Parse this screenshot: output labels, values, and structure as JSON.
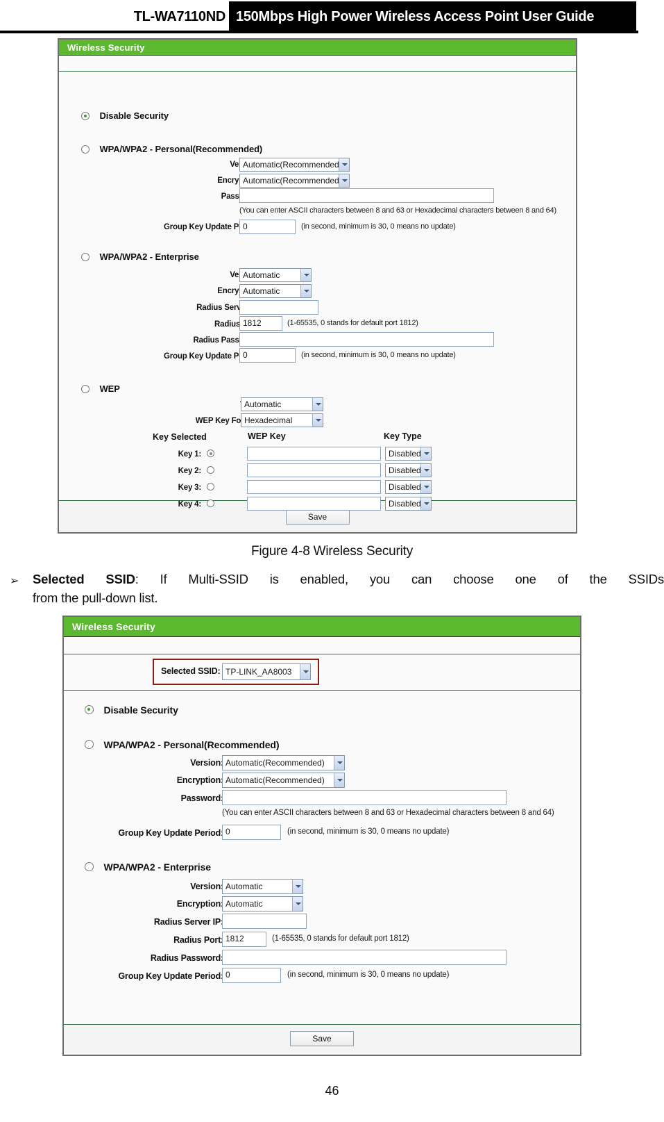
{
  "doc": {
    "model": "TL-WA7110ND",
    "title": "150Mbps High Power Wireless Access Point User Guide",
    "page_number": "46",
    "figure_caption": "Figure 4-8 Wireless Security",
    "bullet": {
      "marker": "➢",
      "term": "Selected SSID",
      "line1_rest": ": If Multi-SSID is enabled, you can choose one of the SSIDs",
      "line2": "from   the pull-down list."
    }
  },
  "colors": {
    "panel_green": "#5cb82e",
    "highlight_red": "#8c1f14",
    "radio_dot_green": "#3f9b2e"
  },
  "panel1": {
    "title": "Wireless Security",
    "save_label": "Save",
    "options": {
      "disable": "Disable Security",
      "personal": "WPA/WPA2 - Personal(Recommended)",
      "enterprise": "WPA/WPA2 - Enterprise",
      "wep": "WEP"
    },
    "selected_option": "disable",
    "personal": {
      "version_label": "Version:",
      "version_value": "Automatic(Recommended)",
      "encryption_label": "Encryption:",
      "encryption_value": "Automatic(Recommended)",
      "password_label": "Password:",
      "password_value": "",
      "password_hint": "(You can enter ASCII characters between 8 and 63 or Hexadecimal characters between 8 and 64)",
      "group_key_label": "Group Key Update Period:",
      "group_key_value": "0",
      "group_key_hint": "(in second, minimum is 30, 0 means no update)"
    },
    "enterprise": {
      "version_label": "Version:",
      "version_value": "Automatic",
      "encryption_label": "Encryption:",
      "encryption_value": "Automatic",
      "radius_ip_label": "Radius Server IP:",
      "radius_ip_value": "",
      "radius_port_label": "Radius Port:",
      "radius_port_value": "1812",
      "radius_port_hint": "(1-65535, 0 stands for default port 1812)",
      "radius_password_label": "Radius Password:",
      "radius_password_value": "",
      "group_key_label": "Group Key Update Period:",
      "group_key_value": "0",
      "group_key_hint": "(in second, minimum is 30, 0 means no update)"
    },
    "wep": {
      "type_label": "Type:",
      "type_value": "Automatic",
      "key_format_label": "WEP Key Format:",
      "key_format_value": "Hexadecimal",
      "col_key_selected": "Key Selected",
      "col_wep_key": "WEP Key",
      "col_key_type": "Key Type",
      "keys": [
        {
          "label": "Key 1:",
          "selected": true,
          "value": "",
          "type": "Disabled"
        },
        {
          "label": "Key 2:",
          "selected": false,
          "value": "",
          "type": "Disabled"
        },
        {
          "label": "Key 3:",
          "selected": false,
          "value": "",
          "type": "Disabled"
        },
        {
          "label": "Key 4:",
          "selected": false,
          "value": "",
          "type": "Disabled"
        }
      ]
    }
  },
  "panel2": {
    "title": "Wireless Security",
    "save_label": "Save",
    "ssid": {
      "label": "Selected SSID:",
      "value": "TP-LINK_AA8003"
    },
    "options": {
      "disable": "Disable Security",
      "personal": "WPA/WPA2 - Personal(Recommended)",
      "enterprise": "WPA/WPA2 - Enterprise"
    },
    "selected_option": "disable",
    "personal": {
      "version_label": "Version:",
      "version_value": "Automatic(Recommended)",
      "encryption_label": "Encryption:",
      "encryption_value": "Automatic(Recommended)",
      "password_label": "Password:",
      "password_value": "",
      "password_hint": "(You can enter ASCII characters between 8 and 63 or Hexadecimal characters between 8 and 64)",
      "group_key_label": "Group Key Update Period:",
      "group_key_value": "0",
      "group_key_hint": "(in second, minimum is 30, 0 means no update)"
    },
    "enterprise": {
      "version_label": "Version:",
      "version_value": "Automatic",
      "encryption_label": "Encryption:",
      "encryption_value": "Automatic",
      "radius_ip_label": "Radius Server IP:",
      "radius_ip_value": "",
      "radius_port_label": "Radius Port:",
      "radius_port_value": "1812",
      "radius_port_hint": "(1-65535, 0 stands for default port 1812)",
      "radius_password_label": "Radius Password:",
      "radius_password_value": "",
      "group_key_label": "Group Key Update Period:",
      "group_key_value": "0",
      "group_key_hint": "(in second, minimum is 30, 0 means no update)"
    }
  }
}
